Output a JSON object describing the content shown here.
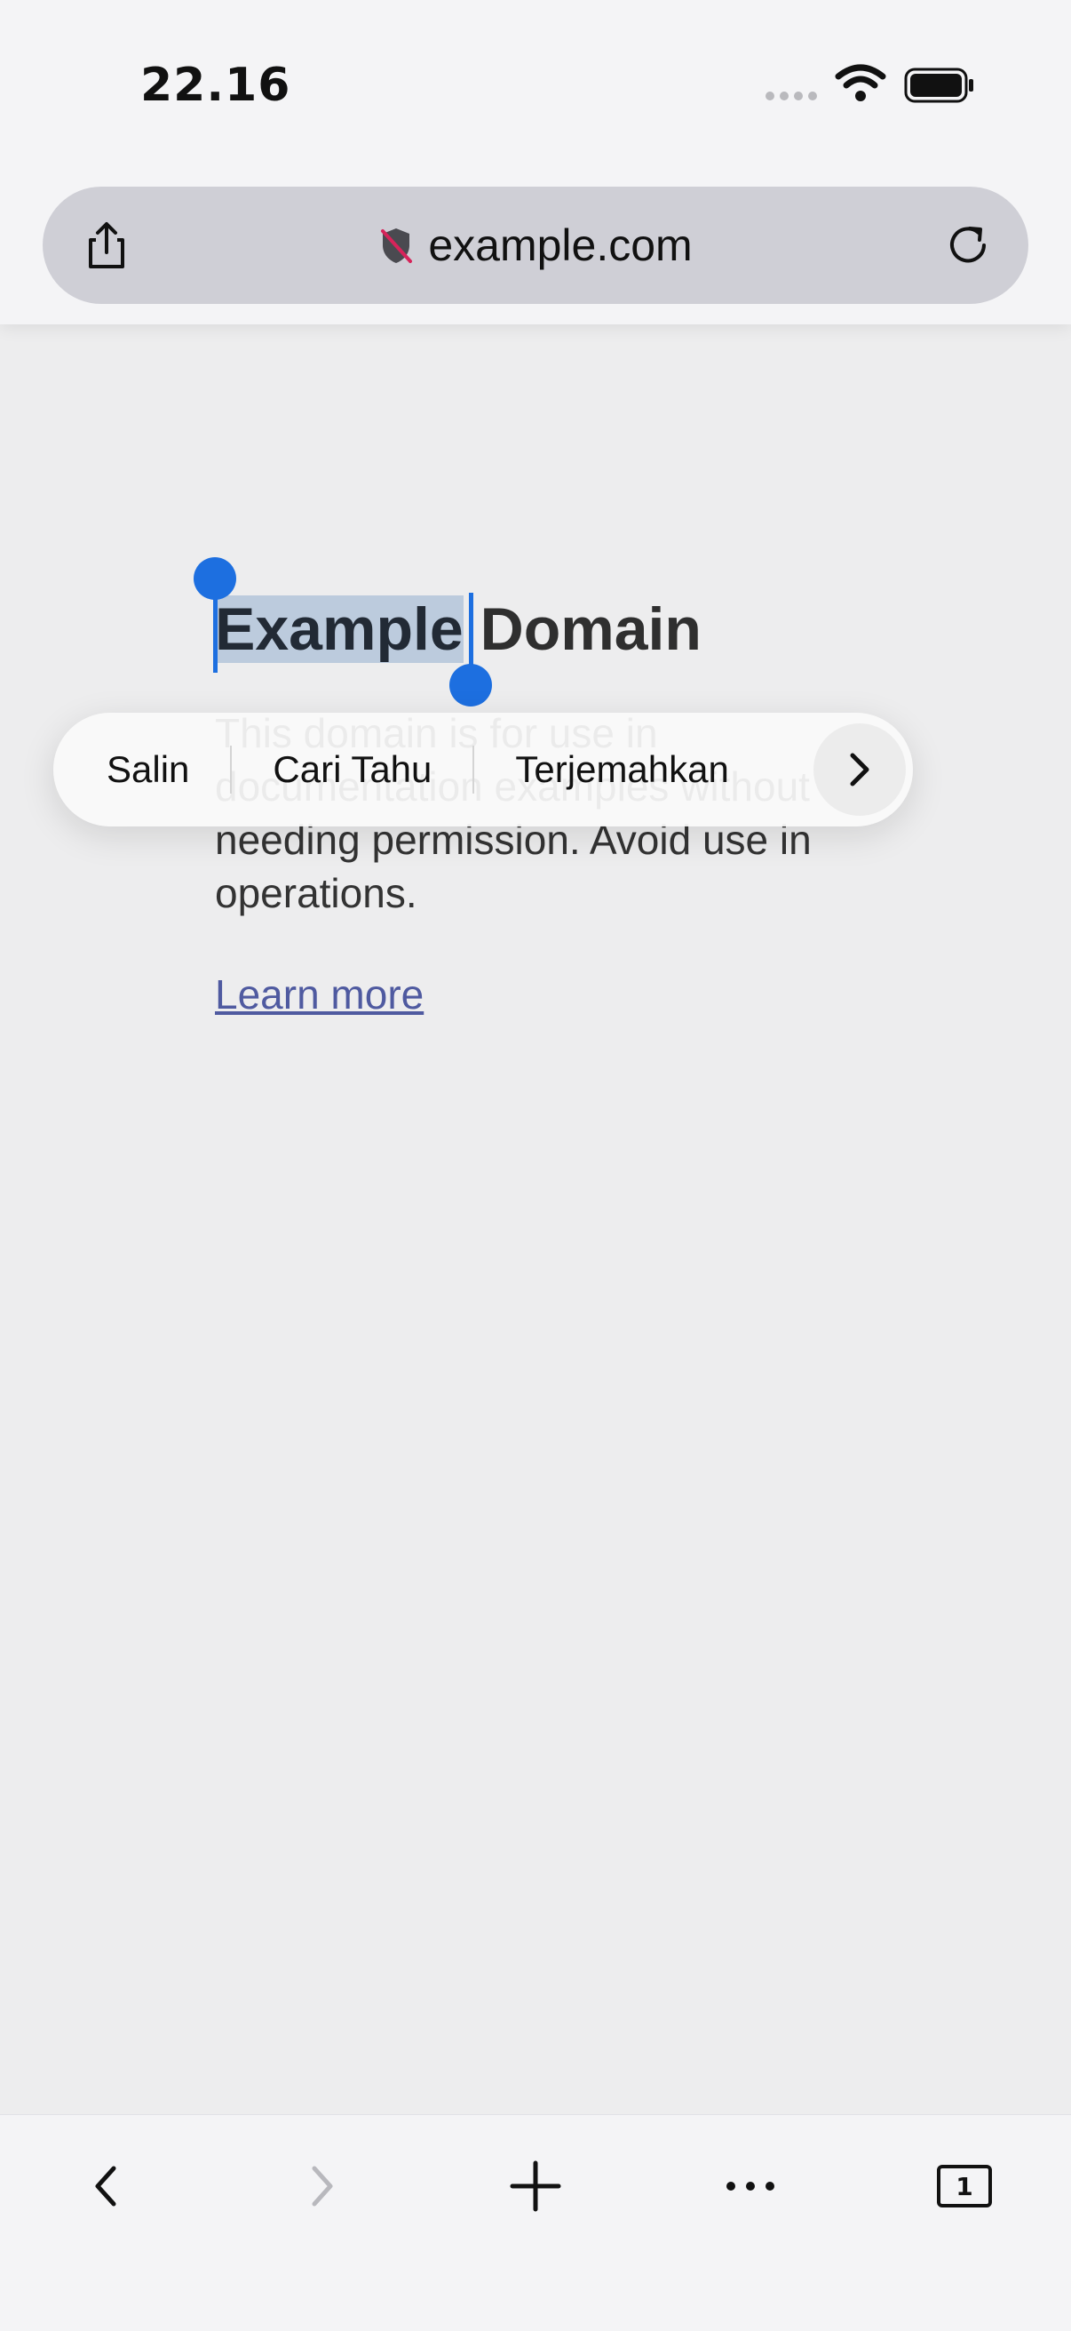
{
  "status_bar": {
    "time": "22.16"
  },
  "url_bar": {
    "url": "example.com"
  },
  "page": {
    "heading_selected": "Example",
    "heading_rest": "Domain",
    "paragraph": "This domain is for use in documentation examples without needing permission. Avoid use in operations.",
    "link": "Learn more"
  },
  "context_menu": {
    "items": [
      "Salin",
      "Cari Tahu",
      "Terjemahkan"
    ]
  },
  "toolbar": {
    "tab_count": "1"
  },
  "icons": {
    "share": "share-icon",
    "privacy": "shield-icon",
    "reload": "reload-icon",
    "back": "chevron-left-icon",
    "forward": "chevron-right-icon",
    "new_tab": "plus-icon",
    "more": "ellipsis-icon",
    "tabs": "tabs-icon",
    "menu_more": "chevron-right-icon"
  },
  "colors": {
    "selection_handle": "#1d6fe0",
    "selection_bg": "#bccbdd",
    "link": "#4f5aa0"
  }
}
